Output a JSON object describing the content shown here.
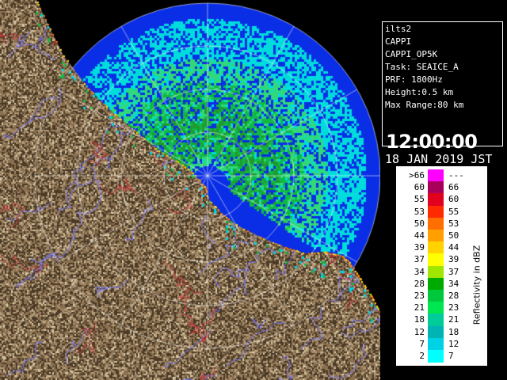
{
  "radar": {
    "site": "ilts2",
    "product": "CAPPI",
    "product_code": "CAPPI_OP5K",
    "task_line": "Task: SEAICE_A",
    "prf_line": "PRF: 1800Hz",
    "height_line": "Height:0.5 km",
    "range_line": "Max Range:80 km",
    "time": "12:00:00",
    "date": "18 JAN 2019 JST"
  },
  "legend": {
    "title": "Reflectivity in dBZ",
    "rows": [
      {
        "low": ">66",
        "high": "---",
        "color": "#ff00ff"
      },
      {
        "low": "60",
        "high": "66",
        "color": "#a8005a"
      },
      {
        "low": "55",
        "high": "60",
        "color": "#e1001e"
      },
      {
        "low": "53",
        "high": "55",
        "color": "#ff2a00"
      },
      {
        "low": "50",
        "high": "53",
        "color": "#ff6e00"
      },
      {
        "low": "44",
        "high": "50",
        "color": "#ffa000"
      },
      {
        "low": "39",
        "high": "44",
        "color": "#ffd200"
      },
      {
        "low": "37",
        "high": "39",
        "color": "#ffff00"
      },
      {
        "low": "34",
        "high": "37",
        "color": "#a0e600"
      },
      {
        "low": "28",
        "high": "34",
        "color": "#00aa00"
      },
      {
        "low": "23",
        "high": "28",
        "color": "#00c83c"
      },
      {
        "low": "21",
        "high": "23",
        "color": "#00e650"
      },
      {
        "low": "18",
        "high": "21",
        "color": "#00cc99"
      },
      {
        "low": "12",
        "high": "18",
        "color": "#00b4b4"
      },
      {
        "low": "7",
        "high": "12",
        "color": "#00d2e6"
      },
      {
        "low": "2",
        "high": "7",
        "color": "#00ffff"
      }
    ]
  },
  "map_colors": {
    "sea": "#0a2ee6",
    "outer_echo": "#00dcdc",
    "land": "#8a7050",
    "land_dark": "#4a3a26",
    "rivers": "#7a7aff",
    "borders": "#c8343a",
    "range_rings": "#ffffff"
  }
}
